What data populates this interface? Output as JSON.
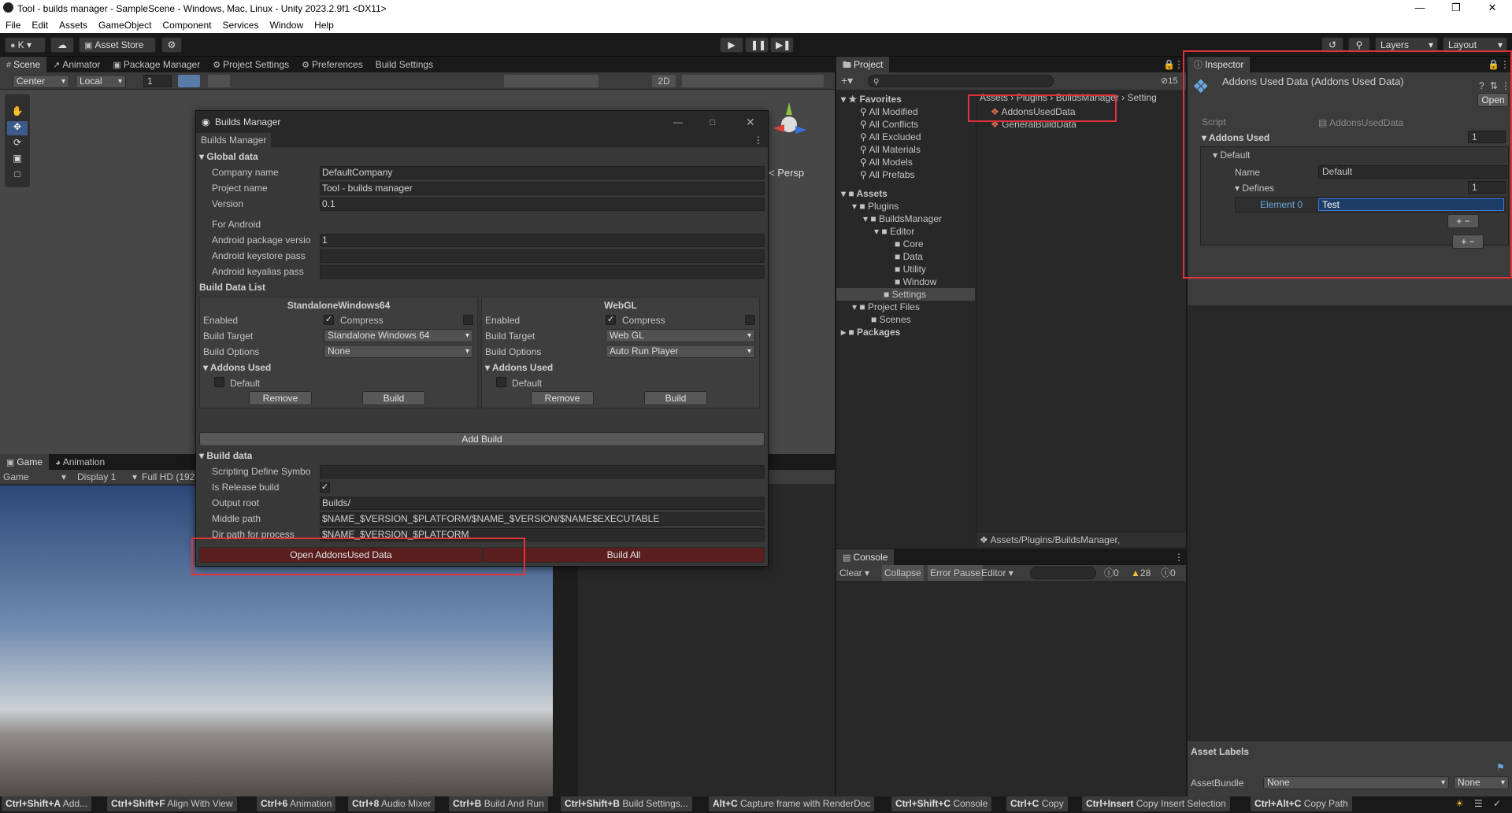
{
  "window": {
    "title": "Tool - builds manager - SampleScene - Windows, Mac, Linux - Unity 2023.2.9f1 <DX11>"
  },
  "menu": [
    "File",
    "Edit",
    "Assets",
    "GameObject",
    "Component",
    "Services",
    "Window",
    "Help"
  ],
  "toolbar": {
    "account": "K",
    "asset_store": "Asset Store",
    "layers": "Layers",
    "layout": "Layout"
  },
  "scene_tabs": [
    "Scene",
    "Animator",
    "Package Manager",
    "Project Settings",
    "Preferences",
    "Build Settings"
  ],
  "scene_toolbar": {
    "pivot": "Center",
    "space": "Local",
    "grid": "1",
    "mode_2d": "2D",
    "persp": "< Persp"
  },
  "game_tabs": [
    "Game",
    "Animation"
  ],
  "game_toolbar": {
    "view": "Game",
    "display": "Display 1",
    "resolution": "Full HD (192"
  },
  "builds_manager": {
    "title": "Builds Manager",
    "tab": "Builds Manager",
    "global_header": "Global data",
    "fields": [
      {
        "label": "Company name",
        "value": "DefaultCompany"
      },
      {
        "label": "Project name",
        "value": "Tool - builds manager"
      },
      {
        "label": "Version",
        "value": "0.1"
      }
    ],
    "android_header": "For Android",
    "android_fields": [
      {
        "label": "Android package versio",
        "value": "1"
      },
      {
        "label": "Android keystore pass",
        "value": ""
      },
      {
        "label": "Android keyalias pass",
        "value": ""
      }
    ],
    "build_list_header": "Build Data List",
    "builds": [
      {
        "name": "StandaloneWindows64",
        "enabled_label": "Enabled",
        "compress_label": "Compress",
        "target_label": "Build Target",
        "target": "Standalone Windows 64",
        "options_label": "Build Options",
        "options": "None",
        "addons_label": "Addons Used",
        "addon": "Default",
        "remove": "Remove",
        "build": "Build"
      },
      {
        "name": "WebGL",
        "enabled_label": "Enabled",
        "compress_label": "Compress",
        "target_label": "Build Target",
        "target": "Web GL",
        "options_label": "Build Options",
        "options": "Auto Run Player",
        "addons_label": "Addons Used",
        "addon": "Default",
        "remove": "Remove",
        "build": "Build"
      }
    ],
    "add_build": "Add Build",
    "build_data_header": "Build data",
    "build_fields": [
      {
        "label": "Scripting Define Symbo",
        "value": ""
      },
      {
        "label": "Is Release build",
        "value": ""
      },
      {
        "label": "Output root",
        "value": "Builds/"
      },
      {
        "label": "Middle path",
        "value": "$NAME_$VERSION_$PLATFORM/$NAME_$VERSION/$NAME$EXECUTABLE"
      },
      {
        "label": "Dir path for process",
        "value": "$NAME_$VERSION_$PLATFORM"
      }
    ],
    "open_addons": "Open AddonsUsed Data",
    "build_all": "Build All"
  },
  "project": {
    "tab": "Project",
    "count": "15",
    "favorites": "Favorites",
    "favorite_items": [
      "All Modified",
      "All Conflicts",
      "All Excluded",
      "All Materials",
      "All Models",
      "All Prefabs"
    ],
    "assets": "Assets",
    "plugins": "Plugins",
    "builds_manager": "BuildsManager",
    "editor": "Editor",
    "editor_items": [
      "Core",
      "Data",
      "Utility",
      "Window"
    ],
    "settings": "Settings",
    "project_files": "Project Files",
    "scenes": "Scenes",
    "packages": "Packages",
    "breadcrumb": [
      "Assets",
      "Plugins",
      "BuildsManager",
      "Setting"
    ],
    "files": [
      "AddonsUsedData",
      "GeneralBuildData"
    ],
    "path": "Assets/Plugins/BuildsManager,"
  },
  "console": {
    "tab": "Console",
    "clear": "Clear",
    "collapse": "Collapse",
    "error_pause": "Error Pause",
    "editor": "Editor",
    "errors": "0",
    "warnings": "28",
    "infos": "0"
  },
  "inspector": {
    "tab": "Inspector",
    "title": "Addons Used Data (Addons Used Data)",
    "open": "Open",
    "script_label": "Script",
    "script_value": "AddonsUsedData",
    "addons_label": "Addons Used",
    "addons_count": "1",
    "default_label": "Default",
    "name_label": "Name",
    "name_value": "Default",
    "defines_label": "Defines",
    "defines_count": "1",
    "element_label": "Element 0",
    "element_value": "Test",
    "asset_labels": "Asset Labels",
    "asset_bundle": "AssetBundle",
    "bundle_value": "None",
    "variant_value": "None"
  },
  "statusbar": [
    {
      "key": "Ctrl+Shift+A",
      "text": "Add..."
    },
    {
      "key": "Ctrl+Shift+F",
      "text": "Align With View"
    },
    {
      "key": "Ctrl+6",
      "text": "Animation"
    },
    {
      "key": "Ctrl+8",
      "text": "Audio Mixer"
    },
    {
      "key": "Ctrl+B",
      "text": "Build And Run"
    },
    {
      "key": "Ctrl+Shift+B",
      "text": "Build Settings..."
    },
    {
      "key": "Alt+C",
      "text": "Capture frame with RenderDoc"
    },
    {
      "key": "Ctrl+Shift+C",
      "text": "Console"
    },
    {
      "key": "Ctrl+C",
      "text": "Copy"
    },
    {
      "key": "Ctrl+Insert",
      "text": "Copy Insert Selection"
    },
    {
      "key": "Ctrl+Alt+C",
      "text": "Copy Path"
    }
  ]
}
